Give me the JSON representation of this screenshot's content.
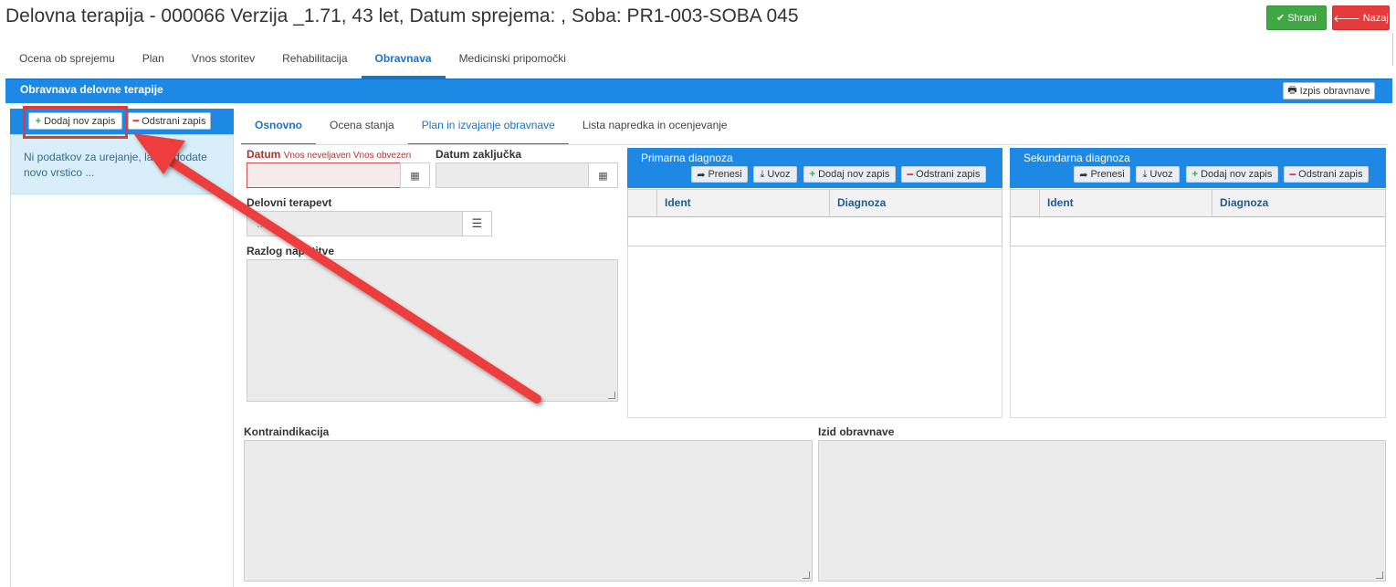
{
  "header": {
    "title": "Delovna terapija - 000066 Verzija _1.71, 43 let, Datum sprejema: , Soba: PR1-003-SOBA 045",
    "save_label": "Shrani",
    "back_label": "Nazaj"
  },
  "main_tabs": [
    {
      "label": "Ocena ob sprejemu"
    },
    {
      "label": "Plan"
    },
    {
      "label": "Vnos storitev"
    },
    {
      "label": "Rehabilitacija"
    },
    {
      "label": "Obravnava",
      "active": true
    },
    {
      "label": "Medicinski pripomočki"
    }
  ],
  "section": {
    "title": "Obravnava delovne terapije",
    "print_label": "Izpis obravnave"
  },
  "left": {
    "add_label": "Dodaj nov zapis",
    "remove_label": "Odstrani zapis",
    "empty_text": "Ni podatkov za urejanje, lahko dodate novo vrstico ..."
  },
  "sub_tabs": [
    {
      "label": "Osnovno",
      "active": true
    },
    {
      "label": "Ocena stanja"
    },
    {
      "label": "Plan in izvajanje obravnave"
    },
    {
      "label": "Lista napredka in ocenjevanje"
    }
  ],
  "form": {
    "datum_label": "Datum",
    "datum_errors": "Vnos neveljaven Vnos obvezen",
    "datum_value": "",
    "datum_zakljucka_label": "Datum zaključka",
    "datum_zakljucka_value": "",
    "terapevt_label": "Delovni terapevt",
    "terapevt_value": "...",
    "razlog_label": "Razlog napotitve",
    "kontraindikacija_label": "Kontraindikacija",
    "izid_label": "Izid obravnave"
  },
  "primary_diagnosis": {
    "title": "Primarna diagnoza",
    "buttons": {
      "transfer": "Prenesi",
      "import": "Uvoz",
      "add": "Dodaj nov zapis",
      "remove": "Odstrani zapis"
    },
    "columns": [
      "Ident",
      "Diagnoza"
    ]
  },
  "secondary_diagnosis": {
    "title": "Sekundarna diagnoza",
    "buttons": {
      "transfer": "Prenesi",
      "import": "Uvoz",
      "add": "Dodaj nov zapis",
      "remove": "Odstrani zapis"
    },
    "columns": [
      "Ident",
      "Diagnoza"
    ]
  },
  "colors": {
    "primary_blue": "#1e88e5",
    "save_green": "#3fa843",
    "back_red": "#e63b3b",
    "annotation_red": "#e53935"
  }
}
